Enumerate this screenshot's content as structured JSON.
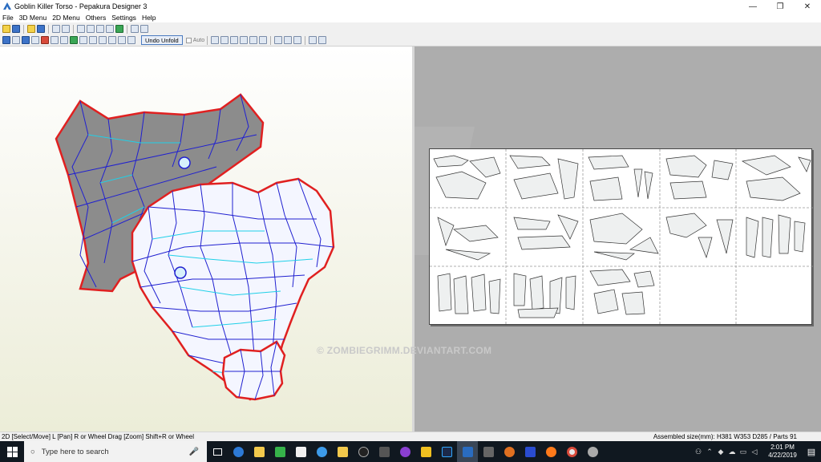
{
  "window": {
    "title": "Goblin Killer Torso - Pepakura Designer 3",
    "minimize": "—",
    "maximize": "❐",
    "close": "✕"
  },
  "menu": [
    "File",
    "3D Menu",
    "2D Menu",
    "Others",
    "Settings",
    "Help"
  ],
  "toolbar": {
    "undo_unfold_label": "Undo Unfold",
    "auto_label": "Auto"
  },
  "watermark": "© ZOMBIEGRIMM.DEVIANTART.COM",
  "status": {
    "left": "2D [Select/Move] L [Pan] R or Wheel Drag [Zoom] Shift+R or Wheel",
    "right": "Assembled size(mm): H381 W353 D285 / Parts 91"
  },
  "taskbar": {
    "search_placeholder": "Type here to search",
    "time": "2:01 PM",
    "date": "4/22/2019"
  },
  "colors": {
    "model_edge": "#e02020",
    "mountain_fold": "#1a1ad0",
    "valley_fold": "#1fd0e8",
    "model_fill": "#8c8c8c",
    "taskbar": "#101820"
  }
}
